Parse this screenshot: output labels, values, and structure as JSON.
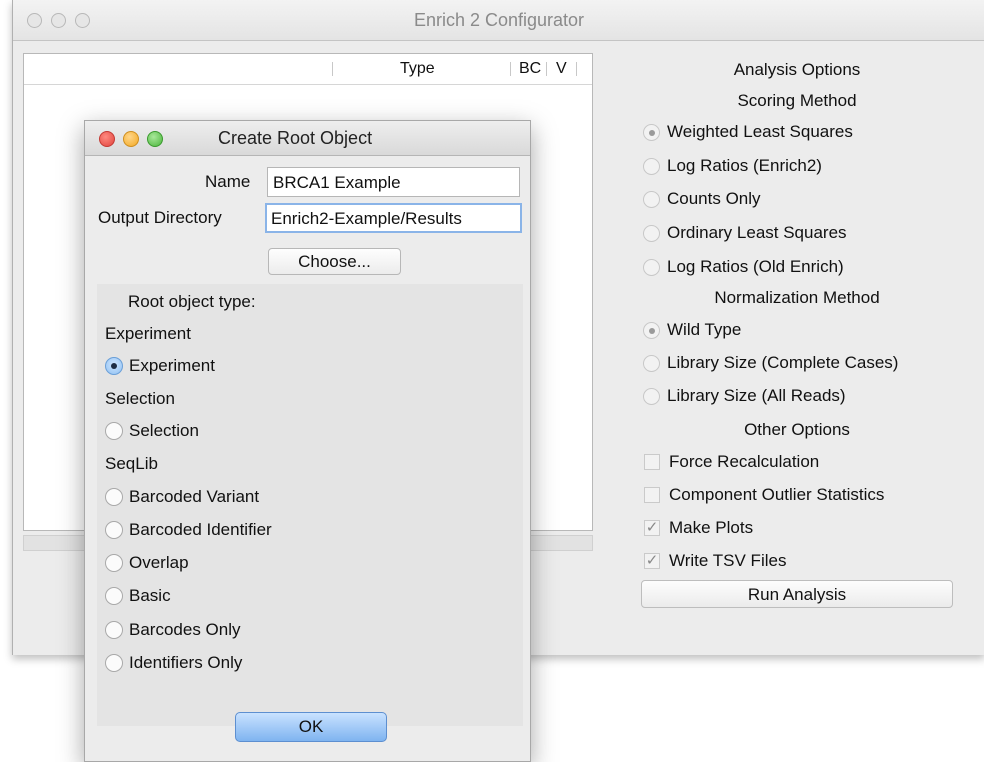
{
  "main_window": {
    "title": "Enrich 2 Configurator",
    "tree_columns": [
      "Type",
      "BC",
      "V"
    ],
    "options": {
      "analysis_heading": "Analysis Options",
      "scoring_heading": "Scoring Method",
      "scoring": [
        {
          "label": "Weighted Least Squares",
          "selected": true
        },
        {
          "label": "Log Ratios (Enrich2)",
          "selected": false
        },
        {
          "label": "Counts Only",
          "selected": false
        },
        {
          "label": "Ordinary Least Squares",
          "selected": false
        },
        {
          "label": "Log Ratios (Old Enrich)",
          "selected": false
        }
      ],
      "normalization_heading": "Normalization Method",
      "normalization": [
        {
          "label": "Wild Type",
          "selected": true
        },
        {
          "label": "Library Size (Complete Cases)",
          "selected": false
        },
        {
          "label": "Library Size (All Reads)",
          "selected": false
        }
      ],
      "other_heading": "Other Options",
      "other": [
        {
          "label": "Force Recalculation",
          "checked": false
        },
        {
          "label": "Component Outlier Statistics",
          "checked": false
        },
        {
          "label": "Make Plots",
          "checked": true
        },
        {
          "label": "Write TSV Files",
          "checked": true
        }
      ],
      "run_label": "Run Analysis"
    }
  },
  "dialog": {
    "title": "Create Root Object",
    "name_label": "Name",
    "name_value": "BRCA1 Example",
    "output_label": "Output Directory",
    "output_value": "Enrich2-Example/Results",
    "choose_label": "Choose...",
    "type_heading": "Root object type:",
    "categories": [
      {
        "label": "Experiment",
        "options": [
          {
            "label": "Experiment",
            "selected": true
          }
        ]
      },
      {
        "label": "Selection",
        "options": [
          {
            "label": "Selection",
            "selected": false
          }
        ]
      },
      {
        "label": "SeqLib",
        "options": [
          {
            "label": "Barcoded Variant",
            "selected": false
          },
          {
            "label": "Barcoded Identifier",
            "selected": false
          },
          {
            "label": "Overlap",
            "selected": false
          },
          {
            "label": "Basic",
            "selected": false
          },
          {
            "label": "Barcodes Only",
            "selected": false
          },
          {
            "label": "Identifiers Only",
            "selected": false
          }
        ]
      }
    ],
    "ok_label": "OK"
  }
}
